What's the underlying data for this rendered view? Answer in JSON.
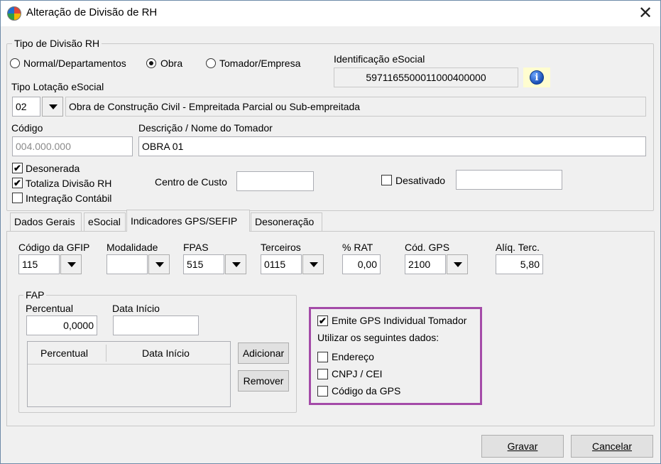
{
  "window": {
    "title": "Alteração de Divisão de RH"
  },
  "tipo_divisao": {
    "legend": "Tipo de Divisão RH",
    "options": [
      "Normal/Departamentos",
      "Obra",
      "Tomador/Empresa"
    ],
    "selected": "Obra"
  },
  "identificacao": {
    "label": "Identificação eSocial",
    "value": "5971165500011000400000"
  },
  "tipo_lotacao": {
    "label": "Tipo Lotação eSocial",
    "code": "02",
    "description": "Obra de Construção Civil - Empreitada Parcial ou Sub-empreitada"
  },
  "codigo": {
    "label": "Código",
    "value": "004.000.000"
  },
  "descricao": {
    "label": "Descrição / Nome do Tomador",
    "value": "OBRA 01"
  },
  "checks": {
    "desonerada": {
      "label": "Desonerada",
      "checked": true
    },
    "totaliza": {
      "label": "Totaliza Divisão RH",
      "checked": true
    },
    "integracao": {
      "label": "Integração Contábil",
      "checked": false
    },
    "desativado": {
      "label": "Desativado",
      "checked": false
    }
  },
  "centro_custo": {
    "label": "Centro de Custo",
    "value": ""
  },
  "desativado_value": "",
  "tabs": [
    "Dados Gerais",
    "eSocial",
    "Indicadores GPS/SEFIP",
    "Desoneração"
  ],
  "active_tab": "Indicadores GPS/SEFIP",
  "gps": {
    "codigo_gfip": {
      "label": "Código da GFIP",
      "value": "115"
    },
    "modalidade": {
      "label": "Modalidade",
      "value": ""
    },
    "fpas": {
      "label": "FPAS",
      "value": "515"
    },
    "terceiros": {
      "label": "Terceiros",
      "value": "0115"
    },
    "rat": {
      "label": "% RAT",
      "value": "0,00"
    },
    "cod_gps": {
      "label": "Cód. GPS",
      "value": "2100"
    },
    "aliq_terc": {
      "label": "Alíq. Terc.",
      "value": "5,80"
    }
  },
  "fap": {
    "legend": "FAP",
    "percentual_label": "Percentual",
    "percentual_value": "0,0000",
    "data_inicio_label": "Data Início",
    "data_inicio_value": "",
    "grid_headers": [
      "Percentual",
      "Data Início"
    ],
    "adicionar_label": "Adicionar",
    "remover_label": "Remover"
  },
  "tomador": {
    "emite": {
      "label": "Emite GPS Individual Tomador",
      "checked": true
    },
    "subtitle": "Utilizar os seguintes dados:",
    "endereco": {
      "label": "Endereço",
      "checked": false
    },
    "cnpj": {
      "label": "CNPJ / CEI",
      "checked": false
    },
    "codigo_gps": {
      "label": "Código da GPS",
      "checked": false
    },
    "highlight_color": "#a44ba8"
  },
  "actions": {
    "gravar": "Gravar",
    "cancelar": "Cancelar"
  }
}
